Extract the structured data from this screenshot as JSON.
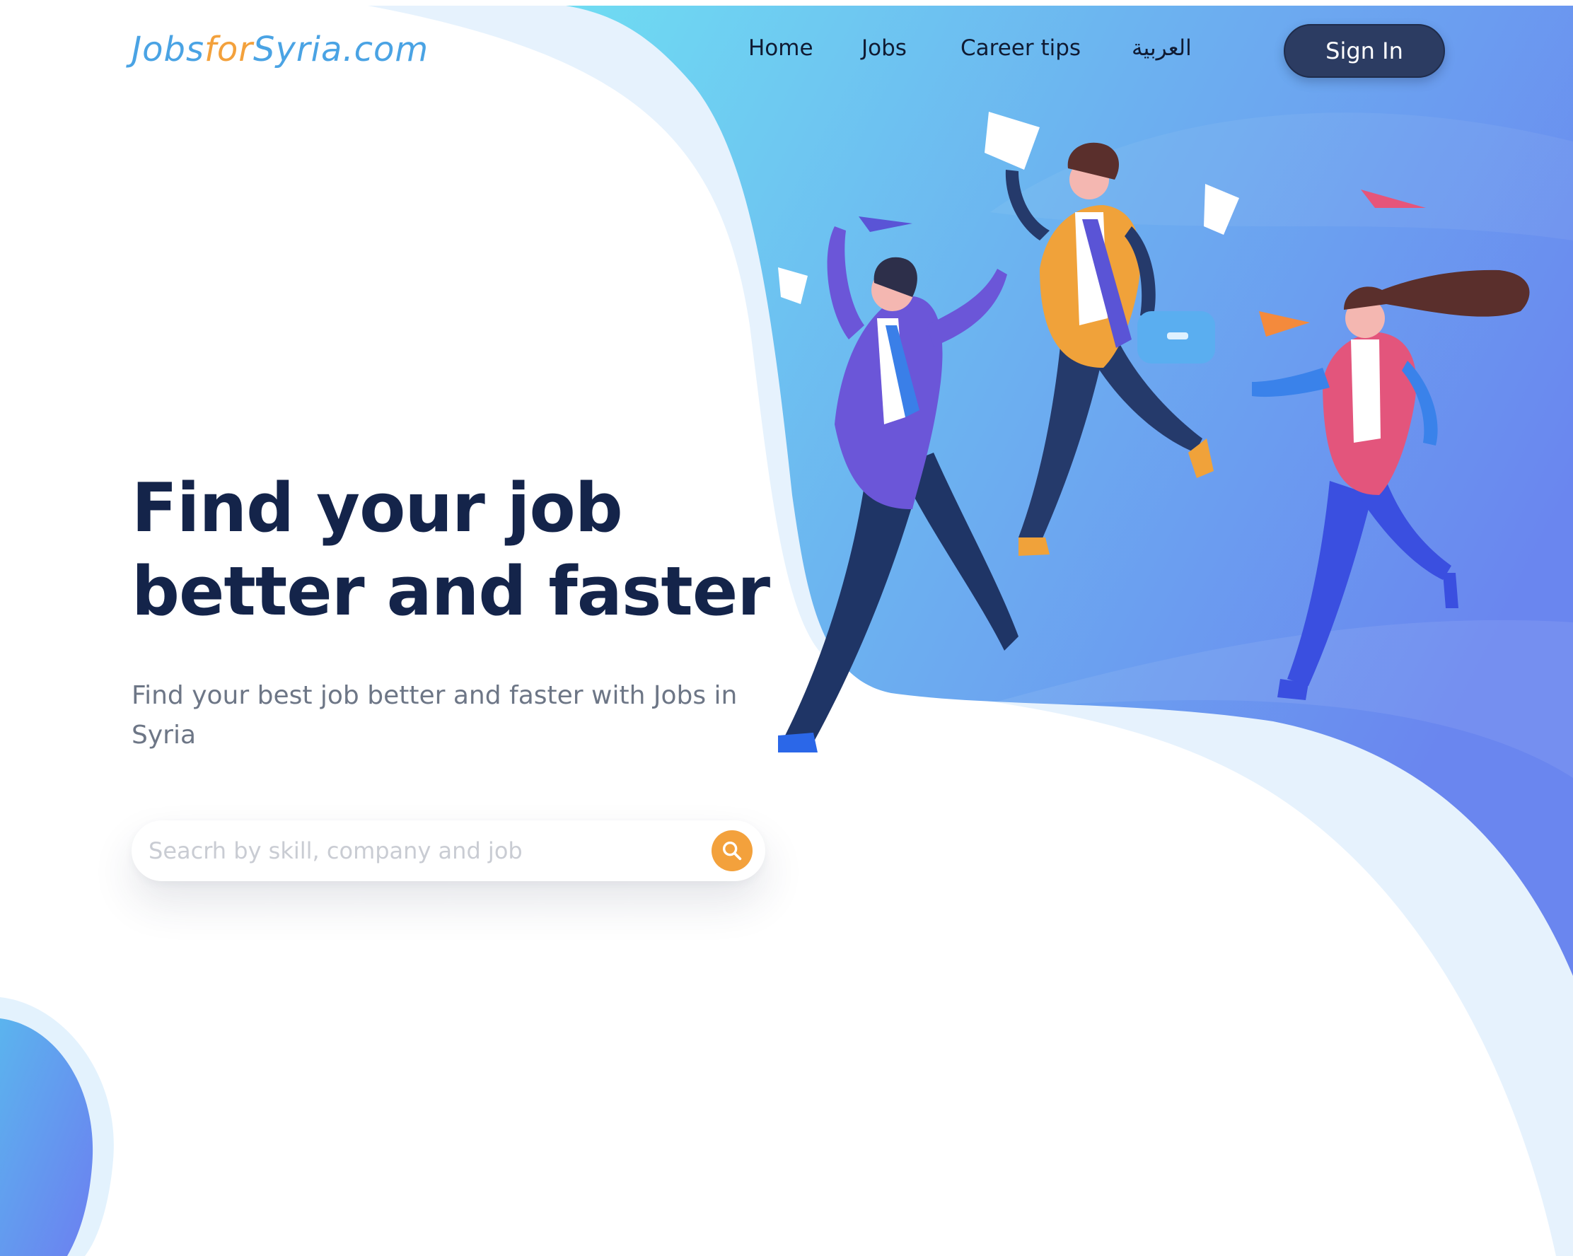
{
  "brand": {
    "logo_part1": "Jobs",
    "logo_part2": "for",
    "logo_part3": "Syria.com",
    "logo_color": "#4aa3e4",
    "logo_accent_color": "#f3a13c"
  },
  "nav": {
    "items": [
      {
        "label": "Home"
      },
      {
        "label": "Jobs"
      },
      {
        "label": "Career tips"
      },
      {
        "label": "العربية"
      }
    ],
    "signin_label": "Sign In",
    "signin_color": "#2c3c62"
  },
  "hero": {
    "title_line1": "Find your job",
    "title_line2": "better and faster",
    "title_color": "#14244a",
    "subtitle": "Find your best job better and faster with Jobs in Syria"
  },
  "search": {
    "placeholder": "Seacrh by skill, company and job",
    "value": "",
    "button_icon": "search-icon",
    "button_color": "#f3a13c"
  },
  "illustration": {
    "description_icon": "jumping-people-illustration",
    "gradient_start": "#6fd8f0",
    "gradient_end": "#6a86ef"
  }
}
